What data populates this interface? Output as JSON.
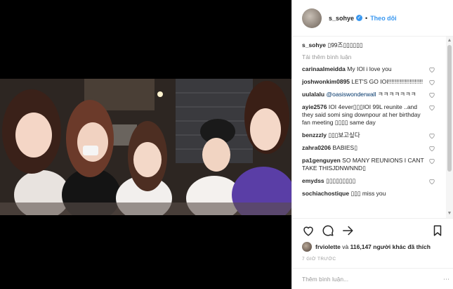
{
  "post": {
    "username": "s_sohye",
    "dot": "•",
    "follow_label": "Theo dõi",
    "caption_text": "▯99즈▯▯▯▯▯▯",
    "load_more": "Tải thêm bình luận"
  },
  "comments": [
    {
      "user": "carinaalmeidda",
      "text": "My IOI i love you"
    },
    {
      "user": "joshwonkim0895",
      "text": "LET'S GO IOI!!!!!!!!!!!!!!!!!!!!!"
    },
    {
      "user": "uulalalu",
      "mention": "@oasiswonderwall",
      "text": "ㅋㅋㅋㅋㅋㅋㅋ"
    },
    {
      "user": "ayie2576",
      "text": "IOI 4ever▯▯▯IOI 99L reunite ..and they said somi sing downpour at her birthday fan meeting ▯▯▯▯ same day"
    },
    {
      "user": "benzzzly",
      "text": "▯▯▯보고싶다"
    },
    {
      "user": "zahra0206",
      "text": "BABIES▯"
    },
    {
      "user": "pa1genguyen",
      "text": "SO MANY REUNIONS I CANT TAKE THISJDNWNND▯"
    },
    {
      "user": "emydss",
      "text": "▯▯▯▯▯▯▯▯▯"
    },
    {
      "user": "sochiachostique",
      "text": "▯▯▯ miss you"
    }
  ],
  "likes": {
    "liker": "frviolette",
    "text_middle": "và",
    "count": "116,147",
    "text_end": "người khác đã thích"
  },
  "time_ago": "7 GIỜ TRƯỚC",
  "comment_box": {
    "placeholder": "Thêm bình luận..."
  },
  "colors": {
    "accent": "#3897f0",
    "text": "#262626",
    "muted": "#999999",
    "border": "#efefef"
  },
  "icons": [
    "heart-icon",
    "comment-icon",
    "share-icon",
    "bookmark-icon",
    "verified-icon",
    "more-options-icon"
  ]
}
